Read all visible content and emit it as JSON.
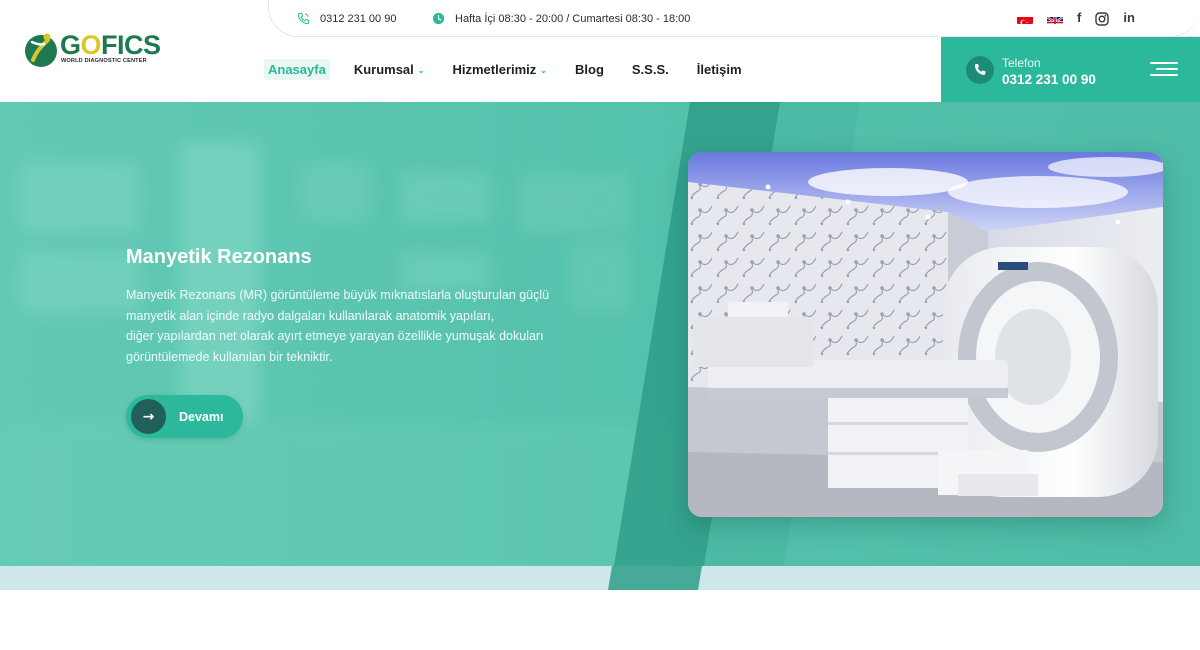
{
  "brand": {
    "logo_text_1": "G",
    "logo_text_o": "O",
    "logo_text_2": "FICS",
    "tagline": "WORLD DIAGNOSTIC CENTER"
  },
  "topbar": {
    "phone": "0312 231 00 90",
    "hours": "Hafta İçi 08:30 - 20:00 / Cumartesi 08:30 - 18:00",
    "social": [
      "f",
      "in"
    ]
  },
  "nav": {
    "items": [
      {
        "label": "Anasayfa",
        "active": true,
        "dropdown": false
      },
      {
        "label": "Kurumsal",
        "active": false,
        "dropdown": true
      },
      {
        "label": "Hizmetlerimiz",
        "active": false,
        "dropdown": true
      },
      {
        "label": "Blog",
        "active": false,
        "dropdown": false
      },
      {
        "label": "S.S.S.",
        "active": false,
        "dropdown": false
      },
      {
        "label": "İletişim",
        "active": false,
        "dropdown": false
      }
    ]
  },
  "phone_box": {
    "label": "Telefon",
    "number": "0312 231 00 90"
  },
  "hero": {
    "title": "Manyetik Rezonans",
    "description_lines": [
      "Manyetik Rezonans (MR) görüntüleme büyük mıknatıslarla oluşturulan güçlü",
      "manyetik alan içinde radyo dalgaları kullanılarak anatomik yapıları,",
      "diğer yapılardan net olarak ayırt etmeye yarayan özellikle yumuşak dokuları",
      "görüntülemede kullanılan bir tekniktir."
    ],
    "button_label": "Devamı"
  },
  "colors": {
    "accent": "#2cb89a",
    "accent_dark": "#21605a",
    "logo_green": "#1e7a4e",
    "logo_yellow": "#d9c72a"
  },
  "icons": {
    "topbar_phone": "phone-icon",
    "topbar_hours": "clock-icon",
    "flags": [
      "turkey-flag-icon",
      "uk-flag-icon"
    ],
    "social": [
      "facebook-icon",
      "instagram-icon",
      "linkedin-icon"
    ],
    "phone_box": "phone-icon",
    "menu": "hamburger-menu-icon",
    "button": "arrow-right-icon"
  }
}
